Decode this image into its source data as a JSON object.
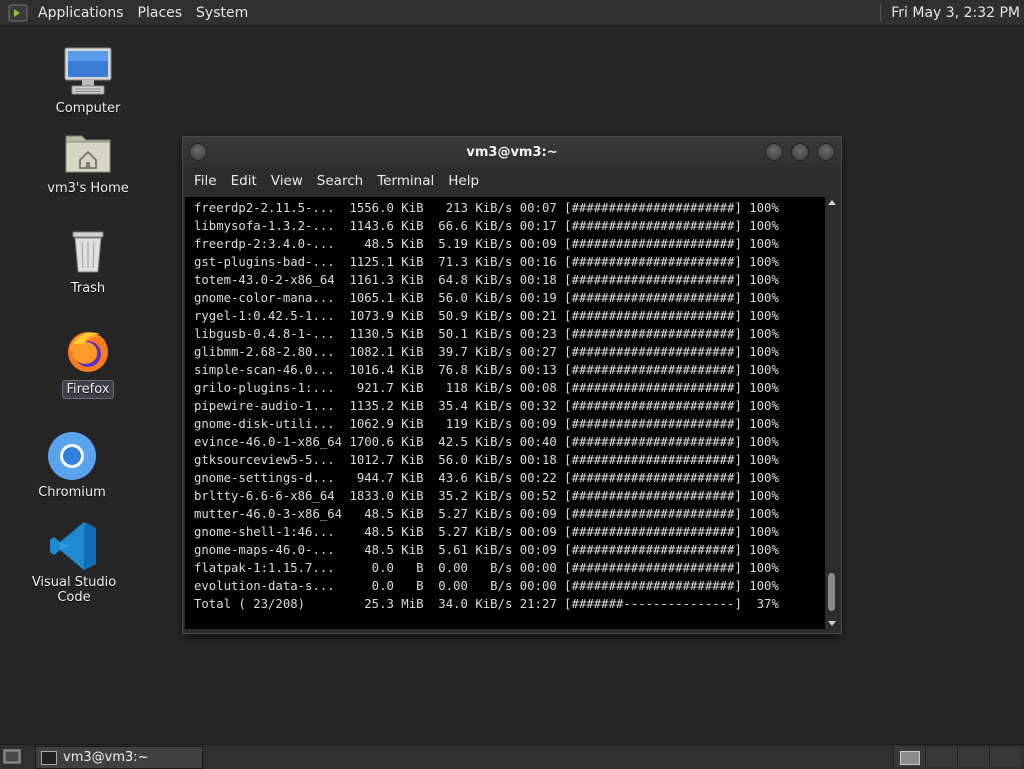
{
  "top_panel": {
    "menus": [
      "Applications",
      "Places",
      "System"
    ],
    "clock": "Fri May  3,  2:32 PM"
  },
  "desktop": {
    "icons": [
      {
        "label": "Computer",
        "icon": "computer-icon"
      },
      {
        "label": "vm3's Home",
        "icon": "home-folder-icon"
      },
      {
        "label": "Trash",
        "icon": "trash-icon"
      },
      {
        "label": "Firefox",
        "icon": "firefox-icon",
        "selected": true
      },
      {
        "label": "Chromium",
        "icon": "chromium-icon"
      },
      {
        "label": "Visual Studio Code",
        "icon": "vscode-icon"
      }
    ]
  },
  "terminal": {
    "title": "vm3@vm3:~",
    "menus": [
      "File",
      "Edit",
      "View",
      "Search",
      "Terminal",
      "Help"
    ],
    "lines": [
      "freerdp2-2.11.5-...  1556.0 KiB   213 KiB/s 00:07 [######################] 100%",
      "libmysofa-1.3.2-...  1143.6 KiB  66.6 KiB/s 00:17 [######################] 100%",
      "freerdp-2:3.4.0-...    48.5 KiB  5.19 KiB/s 00:09 [######################] 100%",
      "gst-plugins-bad-...  1125.1 KiB  71.3 KiB/s 00:16 [######################] 100%",
      "totem-43.0-2-x86_64  1161.3 KiB  64.8 KiB/s 00:18 [######################] 100%",
      "gnome-color-mana...  1065.1 KiB  56.0 KiB/s 00:19 [######################] 100%",
      "rygel-1:0.42.5-1...  1073.9 KiB  50.9 KiB/s 00:21 [######################] 100%",
      "libgusb-0.4.8-1-...  1130.5 KiB  50.1 KiB/s 00:23 [######################] 100%",
      "glibmm-2.68-2.80...  1082.1 KiB  39.7 KiB/s 00:27 [######################] 100%",
      "simple-scan-46.0...  1016.4 KiB  76.8 KiB/s 00:13 [######################] 100%",
      "grilo-plugins-1:...   921.7 KiB   118 KiB/s 00:08 [######################] 100%",
      "pipewire-audio-1...  1135.2 KiB  35.4 KiB/s 00:32 [######################] 100%",
      "gnome-disk-utili...  1062.9 KiB   119 KiB/s 00:09 [######################] 100%",
      "evince-46.0-1-x86_64 1700.6 KiB  42.5 KiB/s 00:40 [######################] 100%",
      "gtksourceview5-5...  1012.7 KiB  56.0 KiB/s 00:18 [######################] 100%",
      "gnome-settings-d...   944.7 KiB  43.6 KiB/s 00:22 [######################] 100%",
      "brltty-6.6-6-x86_64  1833.0 KiB  35.2 KiB/s 00:52 [######################] 100%",
      "mutter-46.0-3-x86_64   48.5 KiB  5.27 KiB/s 00:09 [######################] 100%",
      "gnome-shell-1:46...    48.5 KiB  5.27 KiB/s 00:09 [######################] 100%",
      "gnome-maps-46.0-...    48.5 KiB  5.61 KiB/s 00:09 [######################] 100%",
      "flatpak-1:1.15.7...     0.0   B  0.00   B/s 00:00 [######################] 100%",
      "evolution-data-s...     0.0   B  0.00   B/s 00:00 [######################] 100%",
      "Total ( 23/208)        25.3 MiB  34.0 KiB/s 21:27 [#######---------------]  37%"
    ]
  },
  "taskbar": {
    "window_button": "vm3@vm3:~"
  },
  "colors": {
    "desktop_bg": "#262626",
    "panel_bg": "#2f2f2f",
    "terminal_bg": "#000000",
    "terminal_fg": "#dcdcdc"
  }
}
